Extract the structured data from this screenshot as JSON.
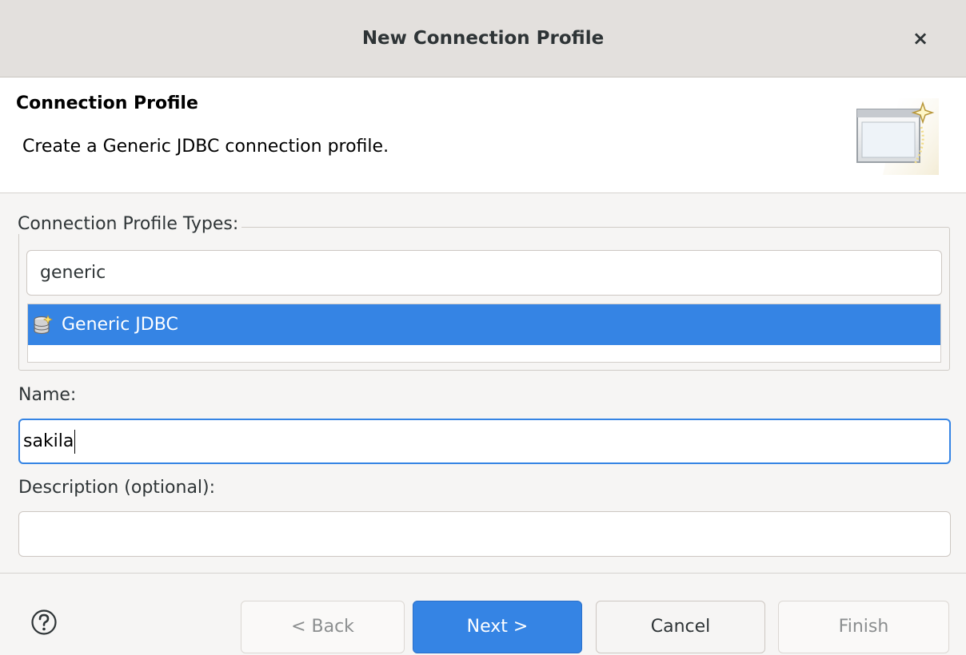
{
  "window": {
    "title": "New Connection Profile",
    "close_glyph": "×"
  },
  "banner": {
    "heading": "Connection Profile",
    "description": "Create a Generic JDBC connection profile.",
    "icon": "new-wizard-icon"
  },
  "profile_types": {
    "legend": "Connection Profile Types:",
    "filter_value": "generic",
    "items": [
      {
        "label": "Generic JDBC",
        "icon": "database-icon",
        "selected": true
      }
    ]
  },
  "name_field": {
    "label": "Name:",
    "value": "sakila"
  },
  "description_field": {
    "label": "Description (optional):",
    "value": ""
  },
  "buttons": {
    "help_icon": "help-icon",
    "back": "< Back",
    "next": "Next >",
    "cancel": "Cancel",
    "finish": "Finish"
  },
  "colors": {
    "accent": "#3584e4",
    "selection_text": "#ffffff"
  }
}
